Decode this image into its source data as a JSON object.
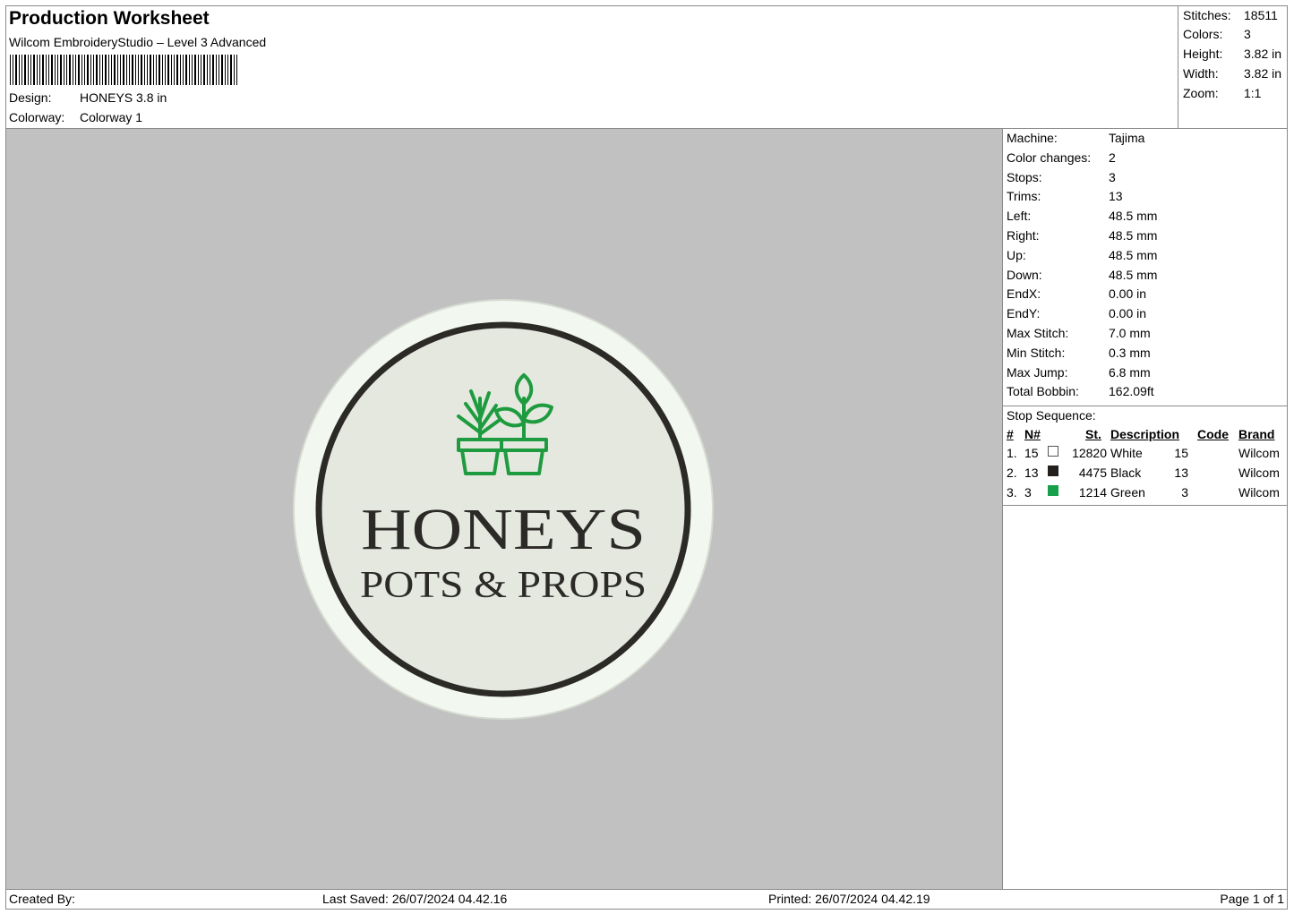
{
  "header": {
    "title": "Production Worksheet",
    "subtitle": "Wilcom EmbroideryStudio – Level 3 Advanced",
    "design_label": "Design:",
    "design_value": "HONEYS 3.8 in",
    "colorway_label": "Colorway:",
    "colorway_value": "Colorway 1"
  },
  "summary": {
    "stitches_label": "Stitches:",
    "stitches_value": "18511",
    "colors_label": "Colors:",
    "colors_value": "3",
    "height_label": "Height:",
    "height_value": "3.82 in",
    "width_label": "Width:",
    "width_value": "3.82 in",
    "zoom_label": "Zoom:",
    "zoom_value": "1:1"
  },
  "design_preview": {
    "line1": "HONEYS",
    "line2": "POTS & PROPS",
    "background_color": "#c1c1c1",
    "fabric_color": "#e4e8df",
    "border_color": "#f2f7ef",
    "ring_color": "#2c2a27",
    "text_color": "#2c2a27",
    "plant_color": "#1e9b3f"
  },
  "machine_info": [
    {
      "label": "Machine:",
      "value": "Tajima"
    },
    {
      "label": "Color changes:",
      "value": "2"
    },
    {
      "label": "Stops:",
      "value": "3"
    },
    {
      "label": "Trims:",
      "value": "13"
    },
    {
      "label": "Left:",
      "value": "48.5 mm"
    },
    {
      "label": "Right:",
      "value": "48.5 mm"
    },
    {
      "label": "Up:",
      "value": "48.5 mm"
    },
    {
      "label": "Down:",
      "value": "48.5 mm"
    },
    {
      "label": "EndX:",
      "value": "0.00 in"
    },
    {
      "label": "EndY:",
      "value": "0.00 in"
    },
    {
      "label": "Max Stitch:",
      "value": "7.0 mm"
    },
    {
      "label": "Min Stitch:",
      "value": "0.3 mm"
    },
    {
      "label": "Max Jump:",
      "value": "6.8 mm"
    },
    {
      "label": "Total Bobbin:",
      "value": "162.09ft"
    }
  ],
  "stop_sequence": {
    "title": "Stop Sequence:",
    "columns": [
      "#",
      "N#",
      "St.",
      "Description",
      "Code",
      "Brand"
    ],
    "rows": [
      {
        "idx": "1.",
        "n": "15",
        "swatch": "#ffffff",
        "st": "12820",
        "desc": "White",
        "code": "15",
        "brand": "Wilcom"
      },
      {
        "idx": "2.",
        "n": "13",
        "swatch": "#231f1c",
        "st": "4475",
        "desc": "Black",
        "code": "13",
        "brand": "Wilcom"
      },
      {
        "idx": "3.",
        "n": "3",
        "swatch": "#17a04a",
        "st": "1214",
        "desc": "Green",
        "code": "3",
        "brand": "Wilcom"
      }
    ]
  },
  "footer": {
    "created_by": "Created By:",
    "last_saved": "Last Saved: 26/07/2024 04.42.16",
    "printed": "Printed: 26/07/2024 04.42.19",
    "page": "Page 1 of 1"
  }
}
